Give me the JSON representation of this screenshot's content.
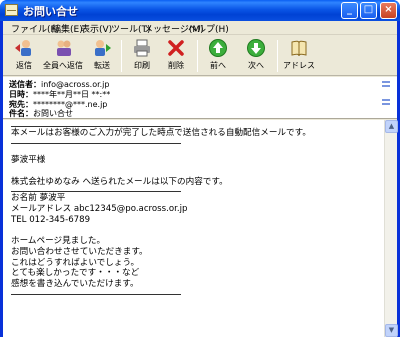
{
  "window": {
    "title": "お問い合せ"
  },
  "menu": [
    "ファイル(F)",
    "編集(E)",
    "表示(V)",
    "ツール(T)",
    "メッセージ(M)",
    "ヘルプ(H)"
  ],
  "toolbar": {
    "reply": "返信",
    "reply_all": "全員へ返信",
    "forward": "転送",
    "print": "印刷",
    "delete": "削除",
    "prev": "前へ",
    "next": "次へ",
    "address": "アドレス"
  },
  "header": {
    "from_label": "送信者：",
    "from_value": "info@across.or.jp",
    "date_label": "日時：",
    "date_value": "****年**月**日 **:**",
    "to_label": "宛先：",
    "to_value": "********@***.ne.jp",
    "subject_label": "件名：",
    "subject_value": "お問い合せ"
  },
  "body": {
    "notice": "本メールはお客様のご入力が完了した時点で送信される自動配信メールです。",
    "greeting": "夢波平様",
    "intro": "株式会社ゆめなみ へ送られたメールは以下の内容です。",
    "name_line": "お名前 夢波平",
    "email_line": "メールアドレス abc12345@po.across.or.jp",
    "tel_line": "TEL 012-345-6789",
    "msg1": "ホームページ見ました。",
    "msg2": "お問い合わせさせていただきます。",
    "msg3": "これはどうすればよいでしょう。",
    "msg4": "とても楽しかったです・・・など",
    "msg5": "感想を書き込んでいただけます。"
  },
  "colors": {
    "titlebar": "#0a55e6",
    "chrome": "#ece9d8"
  }
}
